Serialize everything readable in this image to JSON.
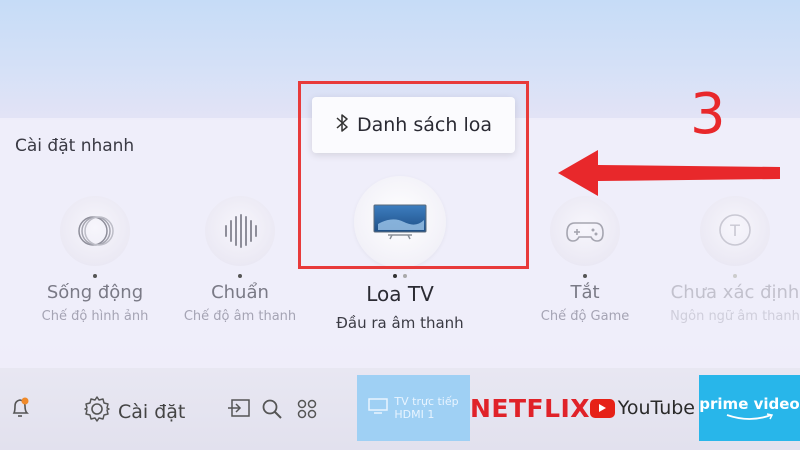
{
  "quick_settings": {
    "title": "Cài đặt nhanh",
    "items": [
      {
        "label": "Sống động",
        "sub": "Chế độ hình ảnh",
        "icon": "picture-mode-icon"
      },
      {
        "label": "Chuẩn",
        "sub": "Chế độ âm thanh",
        "icon": "sound-wave-icon"
      },
      {
        "label": "Loa TV",
        "sub": "Đầu ra âm thanh",
        "icon": "tv-icon"
      },
      {
        "label": "Tắt",
        "sub": "Chế độ Game",
        "icon": "gamepad-icon"
      },
      {
        "label": "Chưa xác định",
        "sub": "Ngôn ngữ âm thanh",
        "icon": "language-icon"
      }
    ]
  },
  "speaker_popup": {
    "label": "Danh sách loa",
    "icon": "bluetooth-icon"
  },
  "annotation": {
    "step_number": "3",
    "color": "#e83a3a"
  },
  "bottom_bar": {
    "settings_label": "Cài đặt",
    "tiles": {
      "tv_label": "TV trực tiếp",
      "tv_sub": "HDMI 1",
      "netflix": "NETFLIX",
      "youtube": "YouTube",
      "prime": "prime video"
    }
  },
  "colors": {
    "netflix_red": "#e02229",
    "youtube_red": "#e62117",
    "prime_blue": "#28b6ea",
    "tv_tile_blue": "#9fd0f4"
  }
}
